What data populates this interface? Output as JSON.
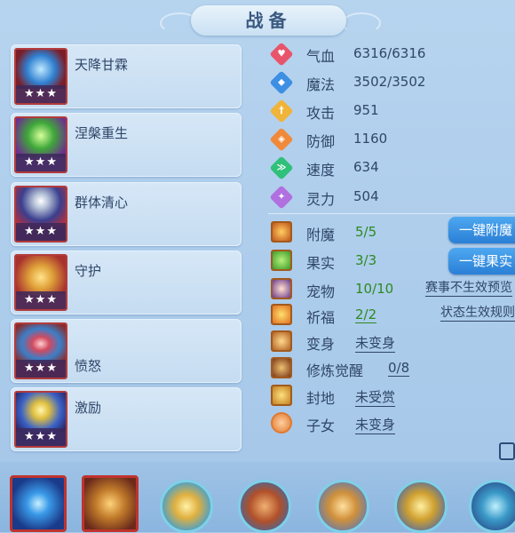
{
  "title": "战备",
  "skills": [
    {
      "name": "天降甘霖",
      "stars": "★★★",
      "icon": "dragon-water-icon"
    },
    {
      "name": "涅槃重生",
      "stars": "★★★",
      "icon": "phoenix-green-icon"
    },
    {
      "name": "群体清心",
      "stars": "★★★",
      "icon": "masked-warrior-icon"
    },
    {
      "name": "守护",
      "stars": "★★★",
      "icon": "golden-dragon-icon"
    },
    {
      "name": "愤怒",
      "stars": "★★★",
      "icon": "eye-orb-icon"
    },
    {
      "name": "激励",
      "stars": "★★★",
      "icon": "lightning-warrior-icon"
    }
  ],
  "stats": [
    {
      "label": "气血",
      "value": "6316/6316",
      "color": "#e8556b",
      "icon": "heart-icon"
    },
    {
      "label": "魔法",
      "value": "3502/3502",
      "color": "#3d8fe3",
      "icon": "mana-icon"
    },
    {
      "label": "攻击",
      "value": "951",
      "color": "#f0b43a",
      "icon": "sword-icon"
    },
    {
      "label": "防御",
      "value": "1160",
      "color": "#f08a3a",
      "icon": "shield-icon"
    },
    {
      "label": "速度",
      "value": "634",
      "color": "#2fc07a",
      "icon": "speed-icon"
    },
    {
      "label": "灵力",
      "value": "504",
      "color": "#b070e0",
      "icon": "spirit-icon"
    }
  ],
  "rows": {
    "enchant": {
      "label": "附魔",
      "value": "5/5"
    },
    "fruit": {
      "label": "果实",
      "value": "3/3"
    },
    "pet": {
      "label": "宠物",
      "value": "10/10"
    },
    "bless": {
      "label": "祈福",
      "value": "2/2"
    },
    "transform": {
      "label": "变身",
      "value": "未变身"
    },
    "awaken": {
      "label": "修炼觉醒",
      "value": "0/8"
    },
    "land": {
      "label": "封地",
      "value": "未受赏"
    },
    "child": {
      "label": "子女",
      "value": "未变身"
    }
  },
  "buttons": {
    "enchant_all": "一键附魔",
    "fruit_all": "一键果实"
  },
  "links": {
    "event_preview": "赛事不生效预览",
    "status_rules": "状态生效规则"
  }
}
